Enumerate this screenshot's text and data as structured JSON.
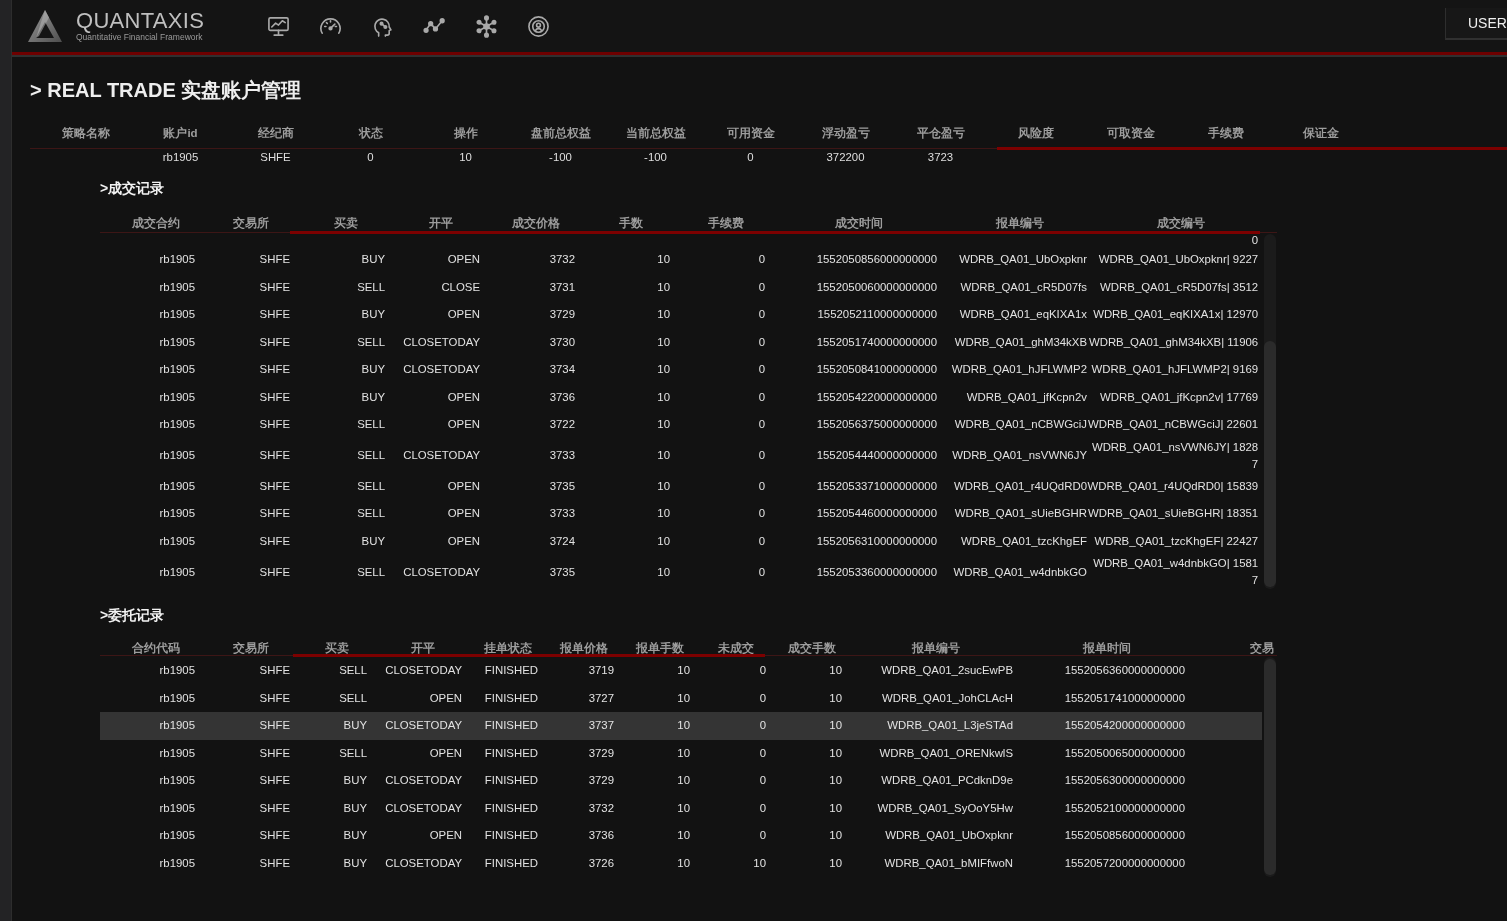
{
  "header": {
    "logo_title": "QUANTAXIS",
    "logo_subtitle": "Quantitative Financial Framework",
    "user_button": "USER"
  },
  "page_title": "> REAL TRADE 实盘账户管理",
  "accounts": {
    "columns": [
      "策略名称",
      "账户id",
      "经纪商",
      "状态",
      "操作",
      "盘前总权益",
      "当前总权益",
      "可用资金",
      "浮动盈亏",
      "平仓盈亏",
      "风险度",
      "可取资金",
      "手续费",
      "保证金"
    ],
    "rows": [
      {
        "account_id": "rb1905",
        "broker": "SHFE",
        "status": "0",
        "operation": "10",
        "pre_equity": "-100",
        "equity": "-100",
        "available": "0",
        "float_pnl": "372200",
        "close_pnl": "3723"
      }
    ]
  },
  "trades": {
    "title": ">成交记录",
    "columns": [
      "成交合约",
      "交易所",
      "买卖",
      "开平",
      "成交价格",
      "手数",
      "手续费",
      "成交时间",
      "报单编号",
      "成交编号"
    ],
    "clipped_row": {
      "trade_id": "0"
    },
    "rows": [
      {
        "contract": "rb1905",
        "exchange": "SHFE",
        "direction": "BUY",
        "offset": "OPEN",
        "price": "3732",
        "volume": "10",
        "commission": "0",
        "time": "1552050856000000000",
        "order_id": "WDRB_QA01_UbOxpknr",
        "trade_id": "WDRB_QA01_UbOxpknr| 9227"
      },
      {
        "contract": "rb1905",
        "exchange": "SHFE",
        "direction": "SELL",
        "offset": "CLOSE",
        "price": "3731",
        "volume": "10",
        "commission": "0",
        "time": "1552050060000000000",
        "order_id": "WDRB_QA01_cR5D07fs",
        "trade_id": "WDRB_QA01_cR5D07fs| 3512"
      },
      {
        "contract": "rb1905",
        "exchange": "SHFE",
        "direction": "BUY",
        "offset": "OPEN",
        "price": "3729",
        "volume": "10",
        "commission": "0",
        "time": "1552052110000000000",
        "order_id": "WDRB_QA01_eqKIXA1x",
        "trade_id": "WDRB_QA01_eqKIXA1x| 12970"
      },
      {
        "contract": "rb1905",
        "exchange": "SHFE",
        "direction": "SELL",
        "offset": "CLOSETODAY",
        "price": "3730",
        "volume": "10",
        "commission": "0",
        "time": "1552051740000000000",
        "order_id": "WDRB_QA01_ghM34kXB",
        "trade_id": "WDRB_QA01_ghM34kXB| 11906"
      },
      {
        "contract": "rb1905",
        "exchange": "SHFE",
        "direction": "BUY",
        "offset": "CLOSETODAY",
        "price": "3734",
        "volume": "10",
        "commission": "0",
        "time": "1552050841000000000",
        "order_id": "WDRB_QA01_hJFLWMP2",
        "trade_id": "WDRB_QA01_hJFLWMP2| 9169"
      },
      {
        "contract": "rb1905",
        "exchange": "SHFE",
        "direction": "BUY",
        "offset": "OPEN",
        "price": "3736",
        "volume": "10",
        "commission": "0",
        "time": "1552054220000000000",
        "order_id": "WDRB_QA01_jfKcpn2v",
        "trade_id": "WDRB_QA01_jfKcpn2v| 17769"
      },
      {
        "contract": "rb1905",
        "exchange": "SHFE",
        "direction": "SELL",
        "offset": "OPEN",
        "price": "3722",
        "volume": "10",
        "commission": "0",
        "time": "1552056375000000000",
        "order_id": "WDRB_QA01_nCBWGciJ",
        "trade_id": "WDRB_QA01_nCBWGciJ| 22601"
      },
      {
        "contract": "rb1905",
        "exchange": "SHFE",
        "direction": "SELL",
        "offset": "CLOSETODAY",
        "price": "3733",
        "volume": "10",
        "commission": "0",
        "time": "1552054440000000000",
        "order_id": "WDRB_QA01_nsVWN6JY",
        "trade_id": "WDRB_QA01_nsVWN6JY| 18287"
      },
      {
        "contract": "rb1905",
        "exchange": "SHFE",
        "direction": "SELL",
        "offset": "OPEN",
        "price": "3735",
        "volume": "10",
        "commission": "0",
        "time": "1552053371000000000",
        "order_id": "WDRB_QA01_r4UQdRD0",
        "trade_id": "WDRB_QA01_r4UQdRD0| 15839"
      },
      {
        "contract": "rb1905",
        "exchange": "SHFE",
        "direction": "SELL",
        "offset": "OPEN",
        "price": "3733",
        "volume": "10",
        "commission": "0",
        "time": "1552054460000000000",
        "order_id": "WDRB_QA01_sUieBGHR",
        "trade_id": "WDRB_QA01_sUieBGHR| 18351"
      },
      {
        "contract": "rb1905",
        "exchange": "SHFE",
        "direction": "BUY",
        "offset": "OPEN",
        "price": "3724",
        "volume": "10",
        "commission": "0",
        "time": "1552056310000000000",
        "order_id": "WDRB_QA01_tzcKhgEF",
        "trade_id": "WDRB_QA01_tzcKhgEF| 22427"
      },
      {
        "contract": "rb1905",
        "exchange": "SHFE",
        "direction": "SELL",
        "offset": "CLOSETODAY",
        "price": "3735",
        "volume": "10",
        "commission": "0",
        "time": "1552053360000000000",
        "order_id": "WDRB_QA01_w4dnbkGO",
        "trade_id": "WDRB_QA01_w4dnbkGO| 15817"
      }
    ]
  },
  "orders": {
    "title": ">委托记录",
    "columns": [
      "合约代码",
      "交易所",
      "买卖",
      "开平",
      "挂单状态",
      "报单价格",
      "报单手数",
      "未成交",
      "成交手数",
      "报单编号",
      "报单时间",
      "交易"
    ],
    "rows": [
      {
        "selected": false,
        "contract": "rb1905",
        "exchange": "SHFE",
        "direction": "SELL",
        "offset": "CLOSETODAY",
        "status": "FINISHED",
        "price": "3719",
        "volume": "10",
        "unfilled": "0",
        "filled": "10",
        "order_id": "WDRB_QA01_2sucEwPB",
        "order_time": "1552056360000000000"
      },
      {
        "selected": false,
        "contract": "rb1905",
        "exchange": "SHFE",
        "direction": "SELL",
        "offset": "OPEN",
        "status": "FINISHED",
        "price": "3727",
        "volume": "10",
        "unfilled": "0",
        "filled": "10",
        "order_id": "WDRB_QA01_JohCLAcH",
        "order_time": "1552051741000000000"
      },
      {
        "selected": true,
        "contract": "rb1905",
        "exchange": "SHFE",
        "direction": "BUY",
        "offset": "CLOSETODAY",
        "status": "FINISHED",
        "price": "3737",
        "volume": "10",
        "unfilled": "0",
        "filled": "10",
        "order_id": "WDRB_QA01_L3jeSTAd",
        "order_time": "1552054200000000000"
      },
      {
        "selected": false,
        "contract": "rb1905",
        "exchange": "SHFE",
        "direction": "SELL",
        "offset": "OPEN",
        "status": "FINISHED",
        "price": "3729",
        "volume": "10",
        "unfilled": "0",
        "filled": "10",
        "order_id": "WDRB_QA01_ORENkwlS",
        "order_time": "1552050065000000000"
      },
      {
        "selected": false,
        "contract": "rb1905",
        "exchange": "SHFE",
        "direction": "BUY",
        "offset": "CLOSETODAY",
        "status": "FINISHED",
        "price": "3729",
        "volume": "10",
        "unfilled": "0",
        "filled": "10",
        "order_id": "WDRB_QA01_PCdknD9e",
        "order_time": "1552056300000000000"
      },
      {
        "selected": false,
        "contract": "rb1905",
        "exchange": "SHFE",
        "direction": "BUY",
        "offset": "CLOSETODAY",
        "status": "FINISHED",
        "price": "3732",
        "volume": "10",
        "unfilled": "0",
        "filled": "10",
        "order_id": "WDRB_QA01_SyOoY5Hw",
        "order_time": "1552052100000000000"
      },
      {
        "selected": false,
        "contract": "rb1905",
        "exchange": "SHFE",
        "direction": "BUY",
        "offset": "OPEN",
        "status": "FINISHED",
        "price": "3736",
        "volume": "10",
        "unfilled": "0",
        "filled": "10",
        "order_id": "WDRB_QA01_UbOxpknr",
        "order_time": "1552050856000000000"
      },
      {
        "selected": false,
        "contract": "rb1905",
        "exchange": "SHFE",
        "direction": "BUY",
        "offset": "CLOSETODAY",
        "status": "FINISHED",
        "price": "3726",
        "volume": "10",
        "unfilled": "10",
        "filled": "10",
        "order_id": "WDRB_QA01_bMIFfwoN",
        "order_time": "1552057200000000000"
      }
    ]
  }
}
